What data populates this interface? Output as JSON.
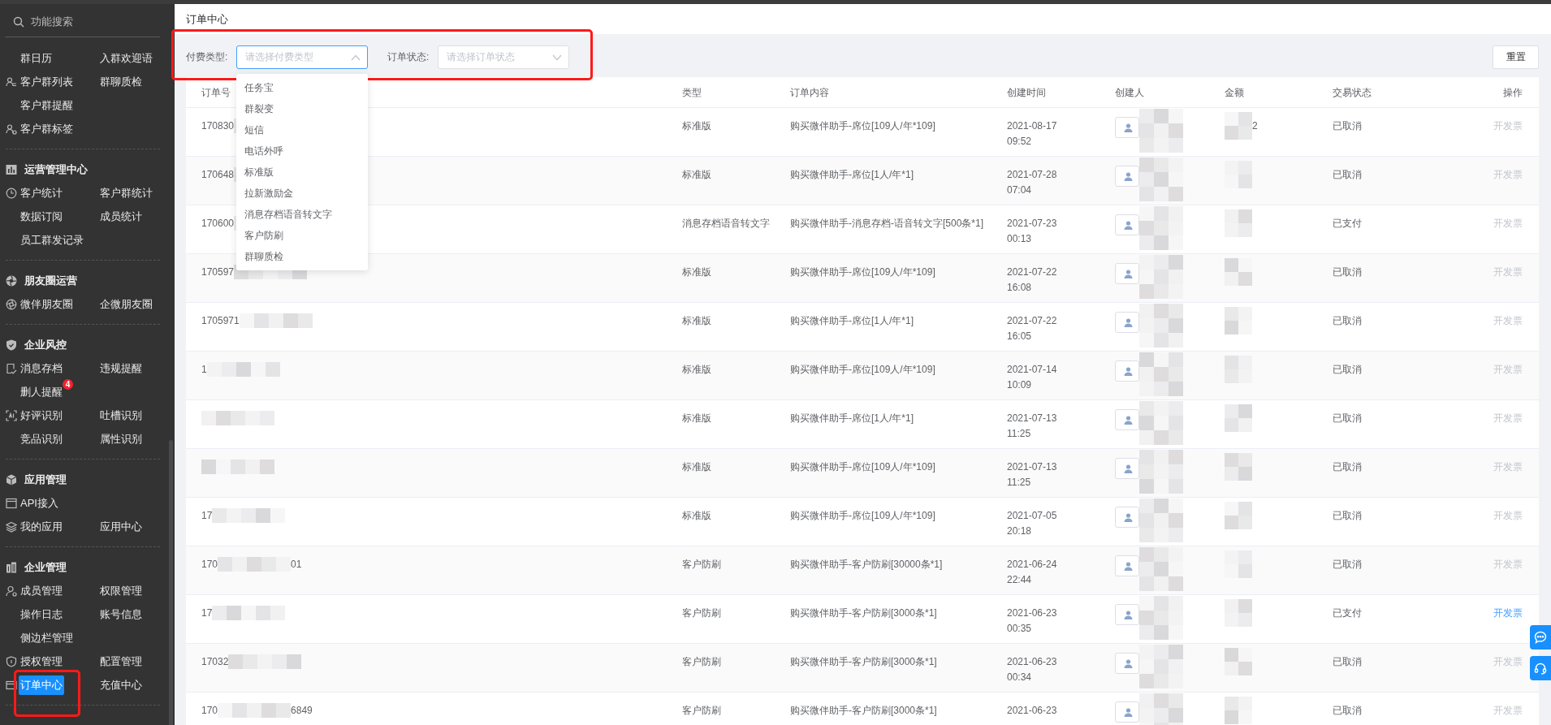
{
  "sidebar": {
    "search_placeholder": "功能搜索",
    "sections": [
      {
        "rows": [
          {
            "icon": false,
            "items": [
              {
                "label": "群日历",
                "selected": false
              },
              {
                "label": "入群欢迎语",
                "selected": false
              }
            ]
          },
          {
            "icon": true,
            "items": [
              {
                "label": "客户群列表",
                "selected": false
              },
              {
                "label": "群聊质检",
                "selected": false
              }
            ]
          },
          {
            "icon": false,
            "items": [
              {
                "label": "客户群提醒",
                "selected": false
              }
            ]
          },
          {
            "icon": true,
            "items": [
              {
                "label": "客户群标签",
                "selected": false
              }
            ]
          }
        ]
      },
      {
        "title": "运营管理中心",
        "rows": [
          {
            "icon": true,
            "items": [
              {
                "label": "客户统计",
                "selected": false
              },
              {
                "label": "客户群统计",
                "selected": false
              }
            ]
          },
          {
            "icon": false,
            "items": [
              {
                "label": "数据订阅",
                "selected": false
              },
              {
                "label": "成员统计",
                "selected": false
              }
            ]
          },
          {
            "icon": false,
            "items": [
              {
                "label": "员工群发记录",
                "selected": false
              }
            ]
          }
        ]
      },
      {
        "title": "朋友圈运营",
        "rows": [
          {
            "icon": true,
            "items": [
              {
                "label": "微伴朋友圈",
                "selected": false
              },
              {
                "label": "企微朋友圈",
                "selected": false
              }
            ]
          }
        ]
      },
      {
        "title": "企业风控",
        "rows": [
          {
            "icon": true,
            "items": [
              {
                "label": "消息存档",
                "selected": false
              },
              {
                "label": "违规提醒",
                "selected": false
              }
            ]
          },
          {
            "icon": false,
            "items": [
              {
                "label": "删人提醒",
                "selected": false,
                "badge": "4"
              }
            ]
          },
          {
            "icon": true,
            "items": [
              {
                "label": "好评识别",
                "selected": false
              },
              {
                "label": "吐槽识别",
                "selected": false
              }
            ]
          },
          {
            "icon": false,
            "items": [
              {
                "label": "竞品识别",
                "selected": false
              },
              {
                "label": "属性识别",
                "selected": false
              }
            ]
          }
        ]
      },
      {
        "title": "应用管理",
        "rows": [
          {
            "icon": true,
            "items": [
              {
                "label": "API接入",
                "selected": false
              }
            ]
          },
          {
            "icon": true,
            "items": [
              {
                "label": "我的应用",
                "selected": false
              },
              {
                "label": "应用中心",
                "selected": false
              }
            ]
          }
        ]
      },
      {
        "title": "企业管理",
        "rows": [
          {
            "icon": true,
            "items": [
              {
                "label": "成员管理",
                "selected": false
              },
              {
                "label": "权限管理",
                "selected": false
              }
            ]
          },
          {
            "icon": false,
            "items": [
              {
                "label": "操作日志",
                "selected": false
              },
              {
                "label": "账号信息",
                "selected": false
              }
            ]
          },
          {
            "icon": false,
            "items": [
              {
                "label": "侧边栏管理",
                "selected": false
              }
            ]
          },
          {
            "icon": true,
            "items": [
              {
                "label": "授权管理",
                "selected": false
              },
              {
                "label": "配置管理",
                "selected": false
              }
            ]
          },
          {
            "icon": true,
            "items": [
              {
                "label": "订单中心",
                "selected": true
              },
              {
                "label": "充值中心",
                "selected": false
              }
            ]
          }
        ]
      }
    ]
  },
  "page_title": "订单中心",
  "filters": [
    {
      "label": "付费类型:",
      "placeholder": "请选择付费类型",
      "expanded": true,
      "options": [
        {
          "label": "任务宝",
          "selected": false
        },
        {
          "label": "群裂变",
          "selected": false
        },
        {
          "label": "短信",
          "selected": false
        },
        {
          "label": "电话外呼",
          "selected": false
        },
        {
          "label": "标准版",
          "selected": false
        },
        {
          "label": "拉新激励金",
          "selected": false
        },
        {
          "label": "消息存档语音转文字",
          "selected": false
        },
        {
          "label": "客户防刷",
          "selected": false
        },
        {
          "label": "群聊质检",
          "selected": false
        }
      ]
    },
    {
      "label": "订单状态:",
      "placeholder": "请选择订单状态",
      "expanded": false
    }
  ],
  "reset_button": "重置",
  "table": {
    "columns": [
      "订单号",
      "类型",
      "订单内容",
      "创建时间",
      "创建人",
      "金额",
      "交易状态",
      "操作"
    ],
    "rows": [
      {
        "order_prefix": "170830",
        "type": "标准版",
        "content": "购买微伴助手-席位[109人/年*109]",
        "date": "2021-08-17",
        "time": "09:52",
        "amount_suffix": "2",
        "status": "已取消",
        "action": "开发票",
        "action_enabled": false
      },
      {
        "order_prefix": "170648",
        "type": "标准版",
        "content": "购买微伴助手-席位[1人/年*1]",
        "date": "2021-07-28",
        "time": "07:04",
        "status": "已取消",
        "action": "开发票",
        "action_enabled": false
      },
      {
        "order_prefix": "170600",
        "type": "消息存档语音转文字",
        "content": "购买微伴助手-消息存档-语音转文字[500条*1]",
        "date": "2021-07-23",
        "time": "00:13",
        "status": "已支付",
        "action": "开发票",
        "action_enabled": false
      },
      {
        "order_prefix": "170597",
        "type": "标准版",
        "content": "购买微伴助手-席位[109人/年*109]",
        "date": "2021-07-22",
        "time": "16:08",
        "status": "已取消",
        "action": "开发票",
        "action_enabled": false
      },
      {
        "order_prefix": "1705971",
        "type": "标准版",
        "content": "购买微伴助手-席位[1人/年*1]",
        "date": "2021-07-22",
        "time": "16:05",
        "status": "已取消",
        "action": "开发票",
        "action_enabled": false
      },
      {
        "order_prefix": "1",
        "type": "标准版",
        "content": "购买微伴助手-席位[109人/年*109]",
        "date": "2021-07-14",
        "time": "10:09",
        "status": "已取消",
        "action": "开发票",
        "action_enabled": false
      },
      {
        "type": "标准版",
        "content": "购买微伴助手-席位[1人/年*1]",
        "date": "2021-07-13",
        "time": "11:25",
        "status": "已取消",
        "action": "开发票",
        "action_enabled": false
      },
      {
        "type": "标准版",
        "content": "购买微伴助手-席位[109人/年*109]",
        "date": "2021-07-13",
        "time": "11:25",
        "status": "已取消",
        "action": "开发票",
        "action_enabled": false
      },
      {
        "order_prefix": "17",
        "type": "标准版",
        "content": "购买微伴助手-席位[109人/年*109]",
        "date": "2021-07-05",
        "time": "20:18",
        "status": "已取消",
        "action": "开发票",
        "action_enabled": false
      },
      {
        "order_prefix": "170",
        "order_suffix": "01",
        "type": "客户防刷",
        "content": "购买微伴助手-客户防刷[30000条*1]",
        "date": "2021-06-24",
        "time": "22:44",
        "status": "已取消",
        "action": "开发票",
        "action_enabled": false
      },
      {
        "order_prefix": "17",
        "type": "客户防刷",
        "content": "购买微伴助手-客户防刷[3000条*1]",
        "date": "2021-06-23",
        "time": "00:35",
        "status": "已支付",
        "action": "开发票",
        "action_enabled": true
      },
      {
        "order_prefix": "17032",
        "type": "客户防刷",
        "content": "购买微伴助手-客户防刷[3000条*1]",
        "date": "2021-06-23",
        "time": "00:34",
        "status": "已取消",
        "action": "开发票",
        "action_enabled": false
      },
      {
        "order_prefix": "170",
        "order_suffix": "6849",
        "type": "客户防刷",
        "content": "购买微伴助手-客户防刷[3000条*1]",
        "date": "2021-06-23",
        "status": "已取消",
        "action": "开发票",
        "action_enabled": false
      }
    ]
  }
}
